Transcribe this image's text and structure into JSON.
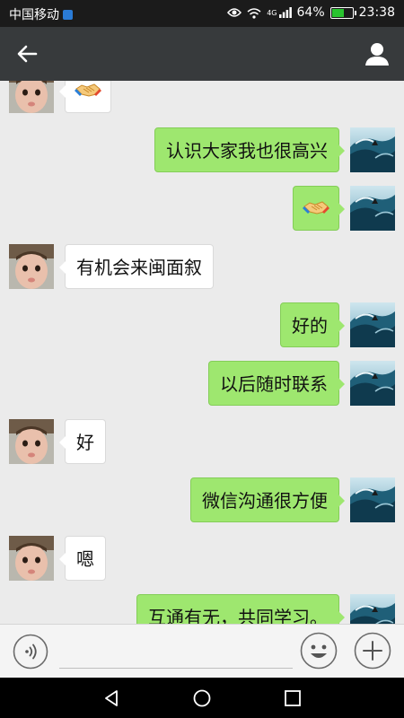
{
  "status_bar": {
    "carrier": "中国移动",
    "network": "4G",
    "battery_text": "64%",
    "battery_level": 0.64,
    "time": "23:38"
  },
  "messages": [
    {
      "side": "left",
      "type": "emoji",
      "emoji": "handshake"
    },
    {
      "side": "right",
      "type": "text",
      "text": "认识大家我也很高兴"
    },
    {
      "side": "right",
      "type": "emoji",
      "emoji": "handshake"
    },
    {
      "side": "left",
      "type": "text",
      "text": "有机会来闽面叙"
    },
    {
      "side": "right",
      "type": "text",
      "text": "好的"
    },
    {
      "side": "right",
      "type": "text",
      "text": "以后随时联系"
    },
    {
      "side": "left",
      "type": "text",
      "text": "好"
    },
    {
      "side": "right",
      "type": "text",
      "text": "微信沟通很方便"
    },
    {
      "side": "left",
      "type": "text",
      "text": "嗯"
    },
    {
      "side": "right",
      "type": "text",
      "text": "互通有无，共同学习。"
    }
  ],
  "input_bar": {
    "placeholder": ""
  },
  "colors": {
    "sent_bubble": "#9ee76f",
    "received_bubble": "#ffffff",
    "title_bar": "#373a3c",
    "chat_background": "#ebebeb"
  },
  "icons": [
    "back-arrow-icon",
    "profile-icon",
    "voice-icon",
    "emoji-icon",
    "plus-icon",
    "nav-back-icon",
    "nav-home-icon",
    "nav-recent-icon"
  ]
}
